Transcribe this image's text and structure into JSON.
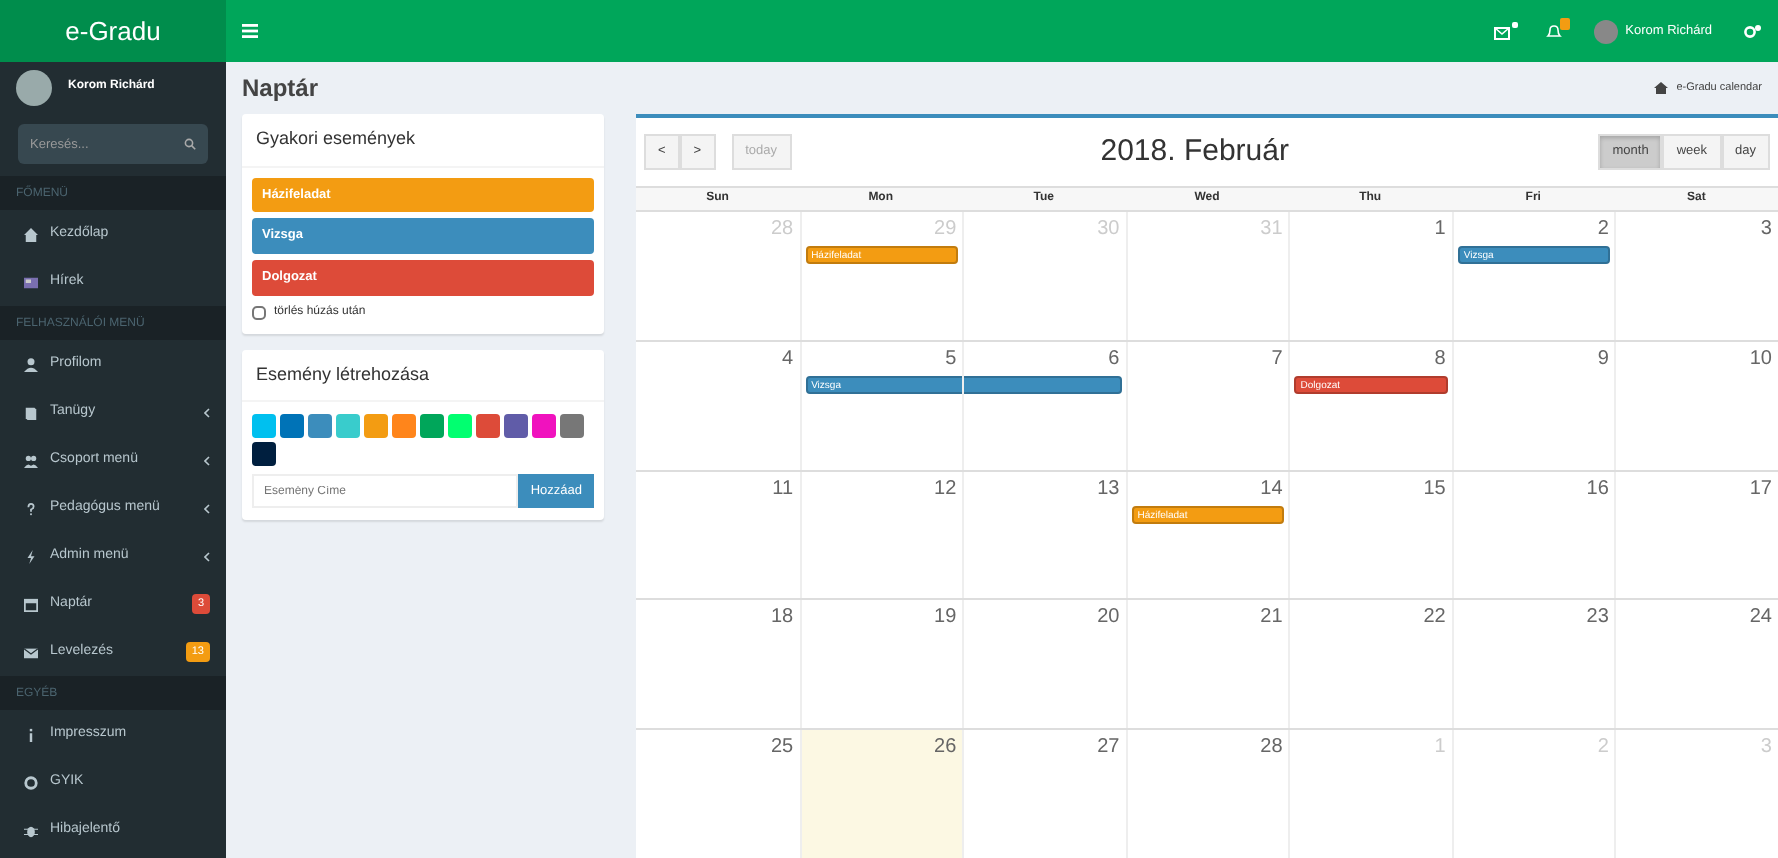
{
  "brand": "e-Gradu",
  "topbar": {
    "user_name": "Korom Richárd",
    "mail_badge": true,
    "bell_badge": true
  },
  "sidebar": {
    "user_name": "Korom Richárd",
    "search": {
      "placeholder": "Keresés..."
    },
    "sections": [
      {
        "header": "FŐMENÜ",
        "items": [
          {
            "label": "Kezdőlap",
            "kind": "home",
            "submenu": false
          },
          {
            "label": "Hírek",
            "kind": "news",
            "submenu": false
          }
        ]
      },
      {
        "header": "FELHASZNÁLÓI MENÜ",
        "items": [
          {
            "label": "Profilom",
            "kind": "user",
            "submenu": false
          },
          {
            "label": "Tanügy",
            "kind": "book",
            "submenu": true
          },
          {
            "label": "Csoport menü",
            "kind": "users",
            "submenu": true
          },
          {
            "label": "Pedagógus menü",
            "kind": "question",
            "submenu": true
          },
          {
            "label": "Admin menü",
            "kind": "bolt",
            "submenu": true
          },
          {
            "label": "Naptár",
            "kind": "calendar",
            "submenu": false,
            "badge": {
              "text": "3",
              "color": "#dd4b39"
            }
          },
          {
            "label": "Levelezés",
            "kind": "envelope",
            "submenu": false,
            "badge": {
              "text": "13",
              "color": "#f39c12"
            }
          }
        ]
      },
      {
        "header": "EGYÉB",
        "items": [
          {
            "label": "Impresszum",
            "kind": "info",
            "submenu": false
          },
          {
            "label": "GYIK",
            "kind": "ring",
            "submenu": false
          },
          {
            "label": "Hibajelentő",
            "kind": "bug",
            "submenu": false
          }
        ]
      }
    ]
  },
  "page_title": "Naptár",
  "breadcrumb": "e-Gradu calendar",
  "frequent_events": {
    "title": "Gyakori események",
    "events": [
      {
        "label": "Házifeladat",
        "color": "#f39c12"
      },
      {
        "label": "Vizsga",
        "color": "#3c8dbc"
      },
      {
        "label": "Dolgozat",
        "color": "#dd4b39"
      }
    ],
    "remove_after_drop": {
      "label": "törlés húzás után",
      "checked": false
    }
  },
  "create_event": {
    "title": "Esemény létrehozása",
    "swatches": [
      {
        "color": "#00c0ef"
      },
      {
        "color": "#0073b7"
      },
      {
        "color": "#3c8dbc"
      },
      {
        "color": "#39cccc"
      },
      {
        "color": "#f39c12"
      },
      {
        "color": "#ff851b"
      },
      {
        "color": "#00a65a"
      },
      {
        "color": "#01ff70"
      },
      {
        "color": "#dd4b39"
      },
      {
        "color": "#605ca8"
      },
      {
        "color": "#f012be"
      },
      {
        "color": "#777777"
      },
      {
        "color": "#001f3f"
      }
    ],
    "input": {
      "placeholder": "Esemény Címe"
    },
    "button": "Hozzáad"
  },
  "calendar": {
    "prev": "<",
    "next": ">",
    "today_button": "today",
    "title": "2018. Február",
    "views": [
      {
        "label": "month",
        "selected": true
      },
      {
        "label": "week",
        "selected": false
      },
      {
        "label": "day",
        "selected": false
      }
    ],
    "weekdays": [
      "Sun",
      "Mon",
      "Tue",
      "Wed",
      "Thu",
      "Fri",
      "Sat"
    ],
    "weeks": [
      {
        "days": [
          {
            "day": "28",
            "other_month": true,
            "today": false
          },
          {
            "day": "29",
            "other_month": true,
            "today": false,
            "events": [
              {
                "kind": "single",
                "title": "Házifeladat",
                "color": "#f39c12"
              }
            ]
          },
          {
            "day": "30",
            "other_month": true,
            "today": false
          },
          {
            "day": "31",
            "other_month": true,
            "today": false
          },
          {
            "day": "1",
            "other_month": false,
            "today": false
          },
          {
            "day": "2",
            "other_month": false,
            "today": false,
            "events": [
              {
                "kind": "single",
                "title": "Vizsga",
                "color": "#3c8dbc"
              }
            ]
          },
          {
            "day": "3",
            "other_month": false,
            "today": false
          }
        ]
      },
      {
        "days": [
          {
            "day": "4",
            "other_month": false,
            "today": false
          },
          {
            "day": "5",
            "other_month": false,
            "today": false,
            "events": [
              {
                "kind": "start",
                "title": "Vizsga",
                "color": "#3c8dbc"
              }
            ]
          },
          {
            "day": "6",
            "other_month": false,
            "today": false,
            "events": [
              {
                "kind": "continuation",
                "color": "#3c8dbc"
              }
            ]
          },
          {
            "day": "7",
            "other_month": false,
            "today": false
          },
          {
            "day": "8",
            "other_month": false,
            "today": false,
            "events": [
              {
                "kind": "single",
                "title": "Dolgozat",
                "color": "#dd4b39"
              }
            ]
          },
          {
            "day": "9",
            "other_month": false,
            "today": false
          },
          {
            "day": "10",
            "other_month": false,
            "today": false
          }
        ]
      },
      {
        "days": [
          {
            "day": "11",
            "other_month": false,
            "today": false
          },
          {
            "day": "12",
            "other_month": false,
            "today": false
          },
          {
            "day": "13",
            "other_month": false,
            "today": false
          },
          {
            "day": "14",
            "other_month": false,
            "today": false,
            "events": [
              {
                "kind": "single",
                "title": "Házifeladat",
                "color": "#f39c12"
              }
            ]
          },
          {
            "day": "15",
            "other_month": false,
            "today": false
          },
          {
            "day": "16",
            "other_month": false,
            "today": false
          },
          {
            "day": "17",
            "other_month": false,
            "today": false
          }
        ]
      },
      {
        "days": [
          {
            "day": "18",
            "other_month": false,
            "today": false
          },
          {
            "day": "19",
            "other_month": false,
            "today": false
          },
          {
            "day": "20",
            "other_month": false,
            "today": false
          },
          {
            "day": "21",
            "other_month": false,
            "today": false
          },
          {
            "day": "22",
            "other_month": false,
            "today": false
          },
          {
            "day": "23",
            "other_month": false,
            "today": false
          },
          {
            "day": "24",
            "other_month": false,
            "today": false
          }
        ]
      },
      {
        "days": [
          {
            "day": "25",
            "other_month": false,
            "today": false
          },
          {
            "day": "26",
            "other_month": false,
            "today": true
          },
          {
            "day": "27",
            "other_month": false,
            "today": false
          },
          {
            "day": "28",
            "other_month": false,
            "today": false
          },
          {
            "day": "1",
            "other_month": true,
            "today": false
          },
          {
            "day": "2",
            "other_month": true,
            "today": false
          },
          {
            "day": "3",
            "other_month": true,
            "today": false
          }
        ]
      }
    ]
  }
}
